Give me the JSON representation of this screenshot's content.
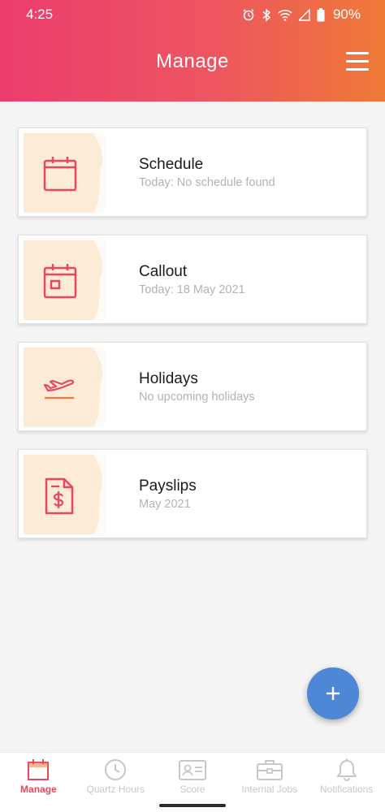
{
  "status_bar": {
    "time": "4:25",
    "battery": "90%",
    "icons": [
      "alarm-icon",
      "bluetooth-icon",
      "wifi-icon",
      "signal-icon",
      "battery-icon"
    ]
  },
  "header": {
    "title": "Manage",
    "menu_icon": "hamburger-menu-icon"
  },
  "colors": {
    "header_start": "#ec3d6e",
    "header_end": "#ef7a36",
    "accent": "#e8475f",
    "fab": "#4e87d6",
    "card_icon_bg": "#fcebd7"
  },
  "cards": [
    {
      "title": "Schedule",
      "subtitle": "Today: No schedule found",
      "icon": "calendar-icon"
    },
    {
      "title": "Callout",
      "subtitle": "Today: 18 May 2021",
      "icon": "calendar-day-icon"
    },
    {
      "title": "Holidays",
      "subtitle": "No upcoming holidays",
      "icon": "airplane-icon"
    },
    {
      "title": "Payslips",
      "subtitle": "May 2021",
      "icon": "payslip-document-icon"
    }
  ],
  "fab": {
    "icon": "plus-icon"
  },
  "bottom_nav": [
    {
      "label": "Manage",
      "icon": "calendar-icon",
      "active": true
    },
    {
      "label": "Quartz Hours",
      "icon": "clock-icon",
      "active": false
    },
    {
      "label": "Score",
      "icon": "id-card-icon",
      "active": false
    },
    {
      "label": "Internal Jobs",
      "icon": "briefcase-icon",
      "active": false
    },
    {
      "label": "Notifications",
      "icon": "bell-icon",
      "active": false
    }
  ]
}
